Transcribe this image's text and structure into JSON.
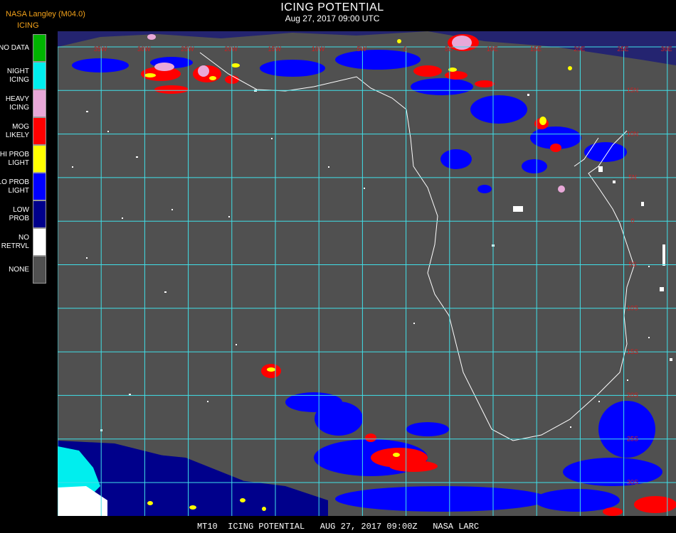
{
  "header": {
    "source": "NASA Langley (M04.0)",
    "product": "ICING",
    "title": "ICING POTENTIAL",
    "datetime": "Aug 27, 2017 09:00 UTC"
  },
  "legend": [
    {
      "label": "NO DATA",
      "color": "#00b400"
    },
    {
      "label": "NIGHT\nICING",
      "color": "#00eeee"
    },
    {
      "label": "HEAVY\nICING",
      "color": "#e8a8d8"
    },
    {
      "label": "MOG\nLIKELY",
      "color": "#ff0000"
    },
    {
      "label": "HI PROB\nLIGHT",
      "color": "#ffff00"
    },
    {
      "label": "LO PROB\nLIGHT",
      "color": "#0000ff"
    },
    {
      "label": "LOW\nPROB",
      "color": "#00008b"
    },
    {
      "label": "NO\nRETRVL",
      "color": "#ffffff"
    },
    {
      "label": "NONE",
      "color": "#505050"
    }
  ],
  "map": {
    "background_color": "#505050",
    "grid_color": "#40e0e8",
    "coastline_color": "#ffffff",
    "grid_label_color": "#cc2222",
    "longitude_labels": [
      "35W",
      "30W",
      "25W",
      "20W",
      "15W",
      "10W",
      "5W",
      "0",
      "5E",
      "10E",
      "15E",
      "20E",
      "25E",
      "30E"
    ],
    "latitude_labels": [
      "15N",
      "10N",
      "5N",
      "0",
      "5S",
      "10S",
      "15S",
      "20S",
      "25S",
      "30S"
    ]
  },
  "footer": {
    "text": "MT10  ICING POTENTIAL   AUG 27, 2017 09:00Z   NASA LARC"
  }
}
